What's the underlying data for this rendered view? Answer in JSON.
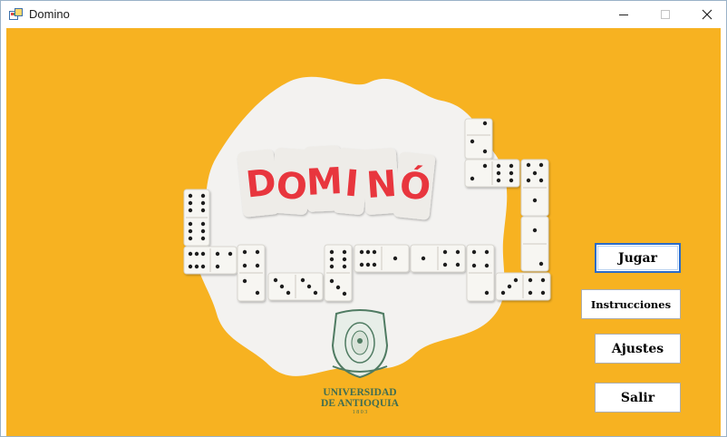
{
  "window": {
    "title": "Domino",
    "controls": {
      "minimize": "minimize-icon",
      "maximize": "maximize-icon",
      "close": "close-icon"
    }
  },
  "logo": {
    "title_letters": [
      "D",
      "O",
      "M",
      "I",
      "N",
      "Ó"
    ],
    "university_line1": "UNIVERSIDAD",
    "university_line2": "DE ANTIOQUIA",
    "founded": "1 8 0 3"
  },
  "menu": {
    "play": "Jugar",
    "instructions": "Instrucciones",
    "settings": "Ajustes",
    "exit": "Salir"
  },
  "colors": {
    "background": "#f7b221",
    "title_red": "#e8363e",
    "accent_blue": "#2a6bc9",
    "university_green": "#3f6d52"
  }
}
